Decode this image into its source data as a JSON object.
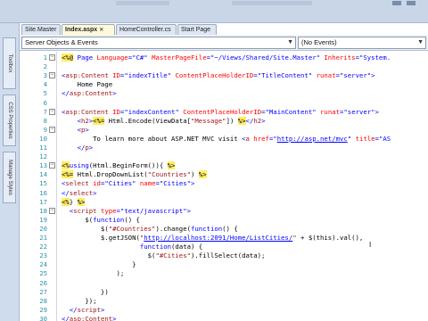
{
  "tabs": [
    {
      "label": "Site.Master"
    },
    {
      "label": "Index.aspx",
      "active": true
    },
    {
      "label": "HomeController.cs"
    },
    {
      "label": "Start Page"
    }
  ],
  "sidebar": [
    "Toolbox",
    "CSS Properties",
    "Manage Styles"
  ],
  "navbar": {
    "objects_value": "Server Objects & Events",
    "events_value": "(No Events)"
  },
  "editor": {
    "lines": [
      {
        "n": "1",
        "fold": "minus",
        "segs": [
          {
            "c": "aspd",
            "t": "<%@"
          },
          {
            "c": "kw",
            "t": " Page "
          },
          {
            "c": "attr",
            "t": "Language"
          },
          {
            "c": "kw",
            "t": "="
          },
          {
            "c": "val",
            "t": "\"C#\""
          },
          {
            "c": "attr",
            "t": " MasterPageFile"
          },
          {
            "c": "kw",
            "t": "="
          },
          {
            "c": "val",
            "t": "\"~/Views/Shared/Site.Master\""
          },
          {
            "c": "attr",
            "t": " Inherits"
          },
          {
            "c": "kw",
            "t": "="
          },
          {
            "c": "val",
            "t": "\"System."
          }
        ]
      },
      {
        "n": "2",
        "segs": []
      },
      {
        "n": "3",
        "fold": "minus",
        "segs": [
          {
            "c": "kw",
            "t": "<"
          },
          {
            "c": "tag",
            "t": "asp:Content"
          },
          {
            "c": "attr",
            "t": " ID"
          },
          {
            "c": "kw",
            "t": "="
          },
          {
            "c": "val",
            "t": "\"indexTitle\""
          },
          {
            "c": "attr",
            "t": " ContentPlaceHolderID"
          },
          {
            "c": "kw",
            "t": "="
          },
          {
            "c": "val",
            "t": "\"TitleContent\""
          },
          {
            "c": "attr",
            "t": " runat"
          },
          {
            "c": "kw",
            "t": "="
          },
          {
            "c": "val",
            "t": "\"server\""
          },
          {
            "c": "kw",
            "t": ">"
          }
        ]
      },
      {
        "n": "4",
        "segs": [
          {
            "c": "txt",
            "t": "    Home Page"
          }
        ]
      },
      {
        "n": "5",
        "segs": [
          {
            "c": "kw",
            "t": "</"
          },
          {
            "c": "tag",
            "t": "asp:Content"
          },
          {
            "c": "kw",
            "t": ">"
          }
        ]
      },
      {
        "n": "6",
        "segs": []
      },
      {
        "n": "7",
        "fold": "minus",
        "segs": [
          {
            "c": "kw",
            "t": "<"
          },
          {
            "c": "tag",
            "t": "asp:Content"
          },
          {
            "c": "attr",
            "t": " ID"
          },
          {
            "c": "kw",
            "t": "="
          },
          {
            "c": "val",
            "t": "\"indexContent\""
          },
          {
            "c": "attr",
            "t": " ContentPlaceHolderID"
          },
          {
            "c": "kw",
            "t": "="
          },
          {
            "c": "val",
            "t": "\"MainContent\""
          },
          {
            "c": "attr",
            "t": " runat"
          },
          {
            "c": "kw",
            "t": "="
          },
          {
            "c": "val",
            "t": "\"server\""
          },
          {
            "c": "kw",
            "t": ">"
          }
        ]
      },
      {
        "n": "8",
        "segs": [
          {
            "c": "kw",
            "t": "    <"
          },
          {
            "c": "tag",
            "t": "h2"
          },
          {
            "c": "kw",
            "t": ">"
          },
          {
            "c": "aspd",
            "t": "<%="
          },
          {
            "c": "txt",
            "t": " Html.Encode(ViewData["
          },
          {
            "c": "str",
            "t": "\"Message\""
          },
          {
            "c": "txt",
            "t": "]) "
          },
          {
            "c": "aspd",
            "t": "%>"
          },
          {
            "c": "kw",
            "t": "</"
          },
          {
            "c": "tag",
            "t": "h2"
          },
          {
            "c": "kw",
            "t": ">"
          }
        ]
      },
      {
        "n": "9",
        "fold": "minus",
        "segs": [
          {
            "c": "kw",
            "t": "    <"
          },
          {
            "c": "tag",
            "t": "p"
          },
          {
            "c": "kw",
            "t": ">"
          }
        ]
      },
      {
        "n": "10",
        "segs": [
          {
            "c": "txt",
            "t": "        To learn more about ASP.NET MVC visit "
          },
          {
            "c": "kw",
            "t": "<"
          },
          {
            "c": "tag",
            "t": "a"
          },
          {
            "c": "attr",
            "t": " href"
          },
          {
            "c": "kw",
            "t": "="
          },
          {
            "c": "val",
            "t": "\""
          },
          {
            "c": "link",
            "t": "http://asp.net/mvc"
          },
          {
            "c": "val",
            "t": "\""
          },
          {
            "c": "attr",
            "t": " title"
          },
          {
            "c": "kw",
            "t": "="
          },
          {
            "c": "val",
            "t": "\"AS"
          }
        ]
      },
      {
        "n": "11",
        "segs": [
          {
            "c": "kw",
            "t": "    </"
          },
          {
            "c": "tag",
            "t": "p"
          },
          {
            "c": "kw",
            "t": ">"
          }
        ]
      },
      {
        "n": "12",
        "segs": []
      },
      {
        "n": "13",
        "fold": "minus",
        "segs": [
          {
            "c": "aspd",
            "t": "<%"
          },
          {
            "c": "kw",
            "t": "using"
          },
          {
            "c": "txt",
            "t": "(Html.BeginForm()){ "
          },
          {
            "c": "aspd",
            "t": "%>"
          }
        ]
      },
      {
        "n": "14",
        "segs": [
          {
            "c": "aspd",
            "t": "<%="
          },
          {
            "c": "txt",
            "t": " Html.DropDownList("
          },
          {
            "c": "str",
            "t": "\"Countries\""
          },
          {
            "c": "txt",
            "t": ") "
          },
          {
            "c": "aspd",
            "t": "%>"
          }
        ]
      },
      {
        "n": "15",
        "segs": [
          {
            "c": "kw",
            "t": "<"
          },
          {
            "c": "tag",
            "t": "select"
          },
          {
            "c": "attr",
            "t": " id"
          },
          {
            "c": "kw",
            "t": "="
          },
          {
            "c": "val",
            "t": "\"Cities\""
          },
          {
            "c": "attr",
            "t": " name"
          },
          {
            "c": "kw",
            "t": "="
          },
          {
            "c": "val",
            "t": "\"Cities\""
          },
          {
            "c": "kw",
            "t": ">"
          }
        ]
      },
      {
        "n": "16",
        "segs": [
          {
            "c": "kw",
            "t": "</"
          },
          {
            "c": "tag",
            "t": "select"
          },
          {
            "c": "kw",
            "t": ">"
          }
        ]
      },
      {
        "n": "17",
        "segs": [
          {
            "c": "aspd",
            "t": "<%"
          },
          {
            "c": "txt",
            "t": "} "
          },
          {
            "c": "aspd",
            "t": "%>"
          }
        ]
      },
      {
        "n": "18",
        "fold": "minus",
        "segs": [
          {
            "c": "kw",
            "t": "  <"
          },
          {
            "c": "tag",
            "t": "script"
          },
          {
            "c": "attr",
            "t": " type"
          },
          {
            "c": "kw",
            "t": "="
          },
          {
            "c": "val",
            "t": "\"text/javascript\""
          },
          {
            "c": "kw",
            "t": ">"
          }
        ]
      },
      {
        "n": "19",
        "segs": [
          {
            "c": "txt",
            "t": "      $("
          },
          {
            "c": "kw",
            "t": "function"
          },
          {
            "c": "txt",
            "t": "() {"
          }
        ]
      },
      {
        "n": "20",
        "segs": [
          {
            "c": "txt",
            "t": "          $("
          },
          {
            "c": "str",
            "t": "\"#Countries\""
          },
          {
            "c": "txt",
            "t": ").change("
          },
          {
            "c": "kw",
            "t": "function"
          },
          {
            "c": "txt",
            "t": "() {"
          }
        ]
      },
      {
        "n": "21",
        "segs": [
          {
            "c": "txt",
            "t": "          $.getJSON("
          },
          {
            "c": "str",
            "t": "\""
          },
          {
            "c": "link",
            "t": "http://localhost:2091/Home/ListCities/"
          },
          {
            "c": "str",
            "t": "\""
          },
          {
            "c": "txt",
            "t": " + $(this).val(),"
          }
        ]
      },
      {
        "n": "22",
        "segs": [
          {
            "c": "kw",
            "t": "                    function"
          },
          {
            "c": "txt",
            "t": "(data) {"
          }
        ]
      },
      {
        "n": "23",
        "segs": [
          {
            "c": "txt",
            "t": "                      $("
          },
          {
            "c": "str",
            "t": "\"#Cities\""
          },
          {
            "c": "txt",
            "t": ").fillSelect(data);"
          }
        ]
      },
      {
        "n": "24",
        "segs": [
          {
            "c": "txt",
            "t": "                  }"
          }
        ]
      },
      {
        "n": "25",
        "segs": [
          {
            "c": "txt",
            "t": "              );"
          }
        ]
      },
      {
        "n": "26",
        "segs": []
      },
      {
        "n": "27",
        "segs": [
          {
            "c": "txt",
            "t": "          })"
          }
        ]
      },
      {
        "n": "28",
        "segs": [
          {
            "c": "txt",
            "t": "      });"
          }
        ]
      },
      {
        "n": "29",
        "segs": [
          {
            "c": "kw",
            "t": "  </"
          },
          {
            "c": "tag",
            "t": "script"
          },
          {
            "c": "kw",
            "t": ">"
          }
        ]
      },
      {
        "n": "30",
        "segs": [
          {
            "c": "kw",
            "t": "</"
          },
          {
            "c": "tag",
            "t": "asp:Content"
          },
          {
            "c": "kw",
            "t": ">"
          }
        ]
      }
    ]
  },
  "colors": {
    "chrome": "#c9d6e8",
    "keyword": "#0000ff",
    "tag": "#a31515",
    "attribute": "#ff0000",
    "server_tag_highlight": "#ffee62",
    "line_number": "#2b91af"
  }
}
